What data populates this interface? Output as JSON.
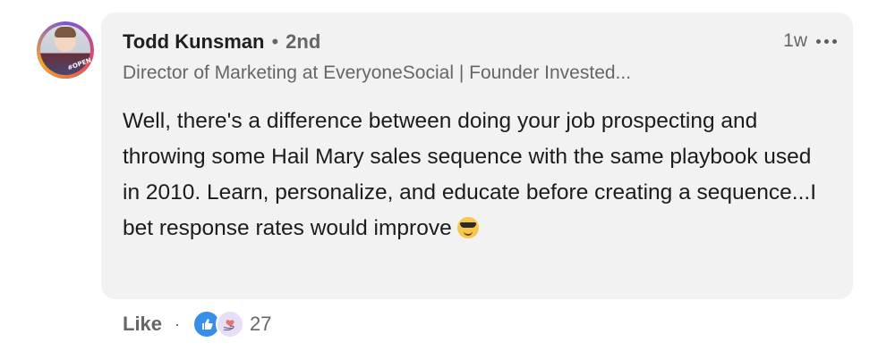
{
  "author": {
    "name": "Todd Kunsman",
    "degree": "2nd",
    "separator": "•",
    "headline": "Director of Marketing at EveryoneSocial | Founder Invested...",
    "avatar_badge": "#OPEN"
  },
  "meta": {
    "time": "1w",
    "more_icon": "more-horizontal-icon"
  },
  "comment": {
    "text": "Well, there's a difference between doing your job prospecting and throwing some Hail Mary sales sequence with the same playbook used in 2010. Learn, personalize, and educate before creating a sequence...I bet response rates would improve",
    "emoji": "smiling-face-with-sunglasses"
  },
  "actions": {
    "like_label": "Like",
    "separator": "·",
    "reaction_icons": [
      "like-reaction-icon",
      "support-reaction-icon"
    ],
    "reaction_count": "27"
  },
  "colors": {
    "bubble_bg": "#f2f2f2",
    "secondary_text": "#666666",
    "like_blue": "#378fe9"
  }
}
